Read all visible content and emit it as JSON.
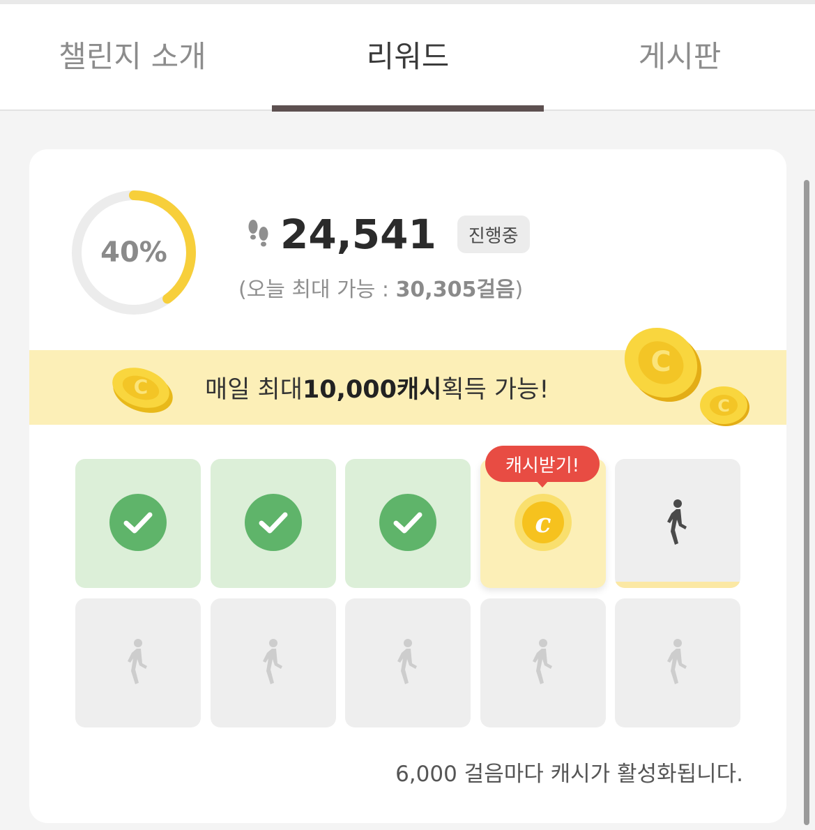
{
  "tabs": [
    {
      "label": "챌린지 소개"
    },
    {
      "label": "리워드"
    },
    {
      "label": "게시판"
    }
  ],
  "progress": {
    "percent_label": "40%",
    "fraction": 0.4,
    "steps": "24,541",
    "status": "진행중",
    "max_prefix": "(오늘 최대 가능 : ",
    "max_value": "30,305걸음",
    "max_suffix": ")"
  },
  "banner": {
    "prefix": "매일 최대 ",
    "highlight": "10,000캐시",
    "suffix": " 획득 가능!"
  },
  "reward_tag": "캐시받기!",
  "grid_cells": [
    "done",
    "done",
    "done",
    "reward",
    "current",
    "locked",
    "locked",
    "locked",
    "locked",
    "locked"
  ],
  "footnote": "6,000 걸음마다 캐시가 활성화됩니다.",
  "colors": {
    "accent_yellow": "#f7cf3b",
    "done_green": "#5fb46a",
    "banner_bg": "#fcefb7",
    "tag_red": "#e84c43",
    "tab_underline": "#5d5050"
  },
  "icons": {
    "steps": "footprints-icon",
    "done": "check-circle-icon",
    "reward": "cash-coin-icon",
    "walking": "walking-person-icon"
  }
}
